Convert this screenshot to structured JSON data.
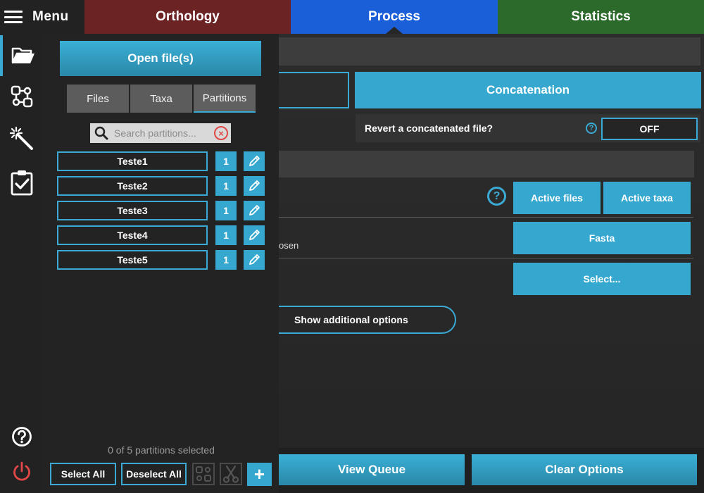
{
  "header": {
    "menu_label": "Menu",
    "tabs": [
      {
        "label": "Orthology",
        "color": "#6b2323"
      },
      {
        "label": "Process",
        "color": "#1b5fd8"
      },
      {
        "label": "Statistics",
        "color": "#2b6a2b"
      }
    ]
  },
  "rail": {
    "items": [
      {
        "icon": "folder-open-icon",
        "active": true
      },
      {
        "icon": "workflow-icon",
        "active": false
      },
      {
        "icon": "magic-wand-icon",
        "active": false
      },
      {
        "icon": "clipboard-check-icon",
        "active": false
      }
    ],
    "bottom": [
      {
        "icon": "help-icon"
      },
      {
        "icon": "power-icon"
      }
    ]
  },
  "panel": {
    "open_files_label": "Open file(s)",
    "tabs": [
      "Files",
      "Taxa",
      "Partitions"
    ],
    "active_tab": "Partitions",
    "search_placeholder": "Search partitions...",
    "partitions": [
      {
        "name": "Teste1",
        "count": "1"
      },
      {
        "name": "Teste2",
        "count": "1"
      },
      {
        "name": "Teste3",
        "count": "1"
      },
      {
        "name": "Teste4",
        "count": "1"
      },
      {
        "name": "Teste5",
        "count": "1"
      }
    ],
    "status": "0 of 5 partitions selected",
    "select_all_label": "Select All",
    "deselect_all_label": "Deselect All",
    "add_label": "+"
  },
  "main": {
    "concatenation_label": "Concatenation",
    "revert_label": "Revert a concatenated file?",
    "revert_toggle": "OFF",
    "help_glyph": "?",
    "active_files_label": "Active files",
    "active_taxa_label": "Active taxa",
    "format_label": "Fasta",
    "select_label": "Select...",
    "partial_text": "osen",
    "show_options_label": "Show additional options",
    "view_queue_label": "View Queue",
    "clear_options_label": "Clear Options"
  },
  "colors": {
    "accent": "#36a8cf",
    "danger": "#e04848"
  }
}
